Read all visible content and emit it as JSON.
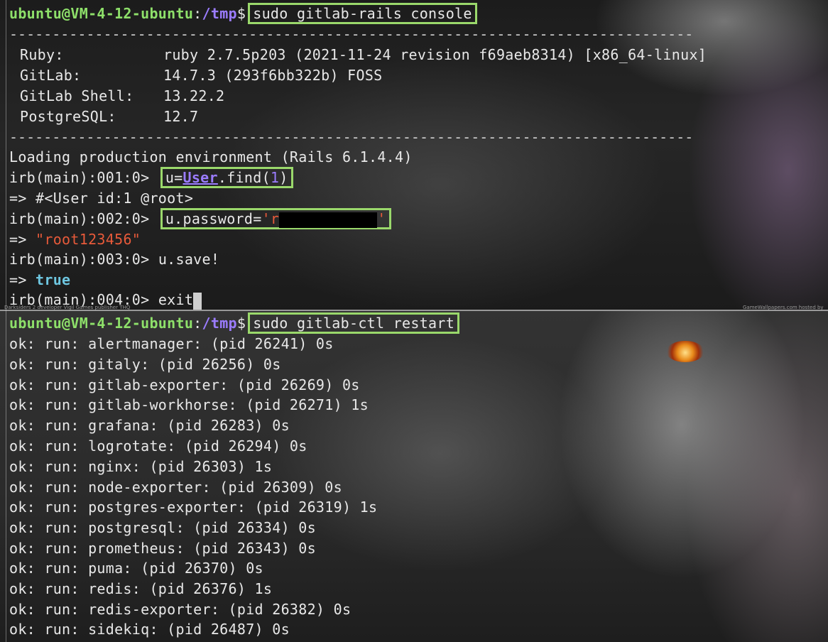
{
  "prompt": {
    "user": "ubuntu@VM-4-12-ubuntu",
    "colon": ":",
    "path": "/tmp",
    "dollar": "$"
  },
  "commands": {
    "console": "sudo gitlab-rails console",
    "restart": "sudo gitlab-ctl restart"
  },
  "separator": "--------------------------------------------------------------------------------",
  "versions": [
    {
      "label": "Ruby:",
      "value": "ruby 2.7.5p203 (2021-11-24 revision f69aeb8314) [x86_64-linux]"
    },
    {
      "label": "GitLab:",
      "value": "14.7.3 (293f6bb322b) FOSS"
    },
    {
      "label": "GitLab Shell:",
      "value": "13.22.2"
    },
    {
      "label": "PostgreSQL:",
      "value": "12.7"
    }
  ],
  "loading": "Loading production environment (Rails 6.1.4.4)",
  "irb": {
    "p1": "irb(main):001:0> ",
    "p2": "irb(main):002:0> ",
    "p3": "irb(main):003:0> ",
    "p4": "irb(main):004:0> ",
    "cmd1_a": "u=",
    "cmd1_cls": "User",
    "cmd1_b": ".find(",
    "cmd1_num": "1",
    "cmd1_c": ")",
    "out1": "=> #<User id:1 @root>",
    "cmd2_a": "u.password=",
    "cmd2_q1": "'r",
    "cmd2_q2": "'",
    "arrow": "=> ",
    "out2_str": "\"root123456\"",
    "cmd3": "u.save!",
    "out3_bool": "true",
    "cmd4": "exit"
  },
  "services": [
    "ok: run: alertmanager: (pid 26241) 0s",
    "ok: run: gitaly: (pid 26256) 0s",
    "ok: run: gitlab-exporter: (pid 26269) 0s",
    "ok: run: gitlab-workhorse: (pid 26271) 1s",
    "ok: run: grafana: (pid 26283) 0s",
    "ok: run: logrotate: (pid 26294) 0s",
    "ok: run: nginx: (pid 26303) 1s",
    "ok: run: node-exporter: (pid 26309) 0s",
    "ok: run: postgres-exporter: (pid 26319) 1s",
    "ok: run: postgresql: (pid 26334) 0s",
    "ok: run: prometheus: (pid 26343) 0s",
    "ok: run: puma: (pid 26370) 0s",
    "ok: run: redis: (pid 26376) 1s",
    "ok: run: redis-exporter: (pid 26382) 0s",
    "ok: run: sidekiq: (pid 26487) 0s"
  ],
  "watermark_left": "Darksiders 2 developer Vigil Games publisher THQ",
  "watermark_right": "GameWallpapers.com hosted by JTLnet.com",
  "colors": {
    "user": "#8ee06a",
    "path": "#9b7cff",
    "highlight": "#9ad86b",
    "string": "#e85a3a",
    "bool": "#6ec6e0"
  }
}
